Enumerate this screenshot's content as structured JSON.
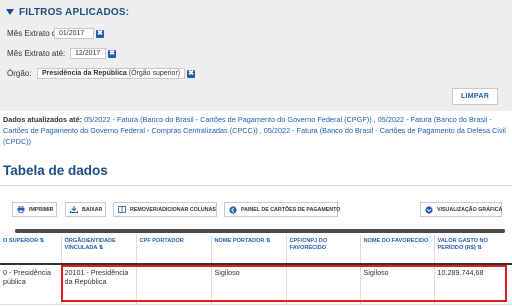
{
  "filters": {
    "title": "FILTROS APLICADOS:",
    "rows": [
      {
        "label": "Mês Extrato de:",
        "value": "01/2017"
      },
      {
        "label": "Mês Extrato até:",
        "value": "12/2017"
      },
      {
        "label": "Órgão:",
        "value_bold": "Presidência da República",
        "value_rest": " (Órgão superior)"
      }
    ],
    "remove_symbol": "✖",
    "clear_label": "LIMPAR"
  },
  "updated": {
    "label": "Dados atualizados até:",
    "text": " 05/2022 - Fatura (Banco do Brasil - Cartões de Pagamento do Governo Federal (CPGF)) , 05/2022 - Fatura (Banco do Brasil - Cartões de Pagamento do Governo Federal - Compras Centralizadas (CPCC)) , 05/2022 - Fatura (Banco do Brasil - Cartões de Pagamento da Defesa Civil (CPDC))"
  },
  "table_title": "Tabela de dados",
  "toolbar": {
    "print": "IMPRIMIR",
    "download": "BAIXAR",
    "columns": "REMOVER/ADICIONAR COLUNAS",
    "panel": "PAINEL DE CARTÕES DE PAGAMENTO",
    "graphic": "VISUALIZAÇÃO GRÁFICA"
  },
  "table": {
    "headers": [
      "O SUPERIOR ⇅",
      "ÓRGÃO/ENTIDADE VINCULADA ⇅",
      "CPF PORTADOR",
      "NOME PORTADOR ⇅",
      "CPF/CNPJ DO FAVORECIDO",
      "NOME DO FAVORECIDO",
      "VALOR GASTO NO PERÍODO (R$) ⇅"
    ],
    "rows": [
      [
        "0 - Presidência\npública",
        "20101 - Presidência da República",
        "",
        "Sigiloso",
        "",
        "Sigiloso",
        "10.289.744,68"
      ]
    ]
  },
  "colors": {
    "primary": "#1f5fae",
    "highlight": "#e31b23"
  }
}
